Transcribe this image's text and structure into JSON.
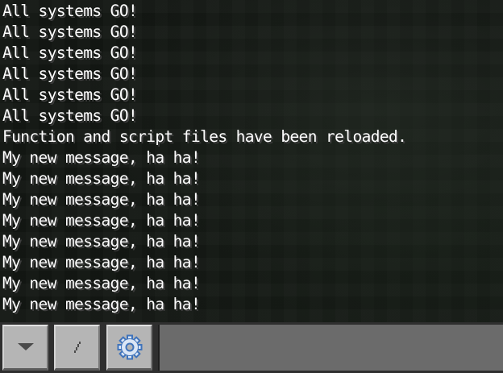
{
  "chat": {
    "lines": [
      "All systems GO!",
      "All systems GO!",
      "All systems GO!",
      "All systems GO!",
      "All systems GO!",
      "All systems GO!",
      "Function and script files have been reloaded.",
      "My new message, ha ha!",
      "My new message, ha ha!",
      "My new message, ha ha!",
      "My new message, ha ha!",
      "My new message, ha ha!",
      "My new message, ha ha!",
      "My new message, ha ha!",
      "My new message, ha ha!"
    ]
  },
  "input_bar": {
    "menu_icon": "chevron-down-icon",
    "slash_label": "/",
    "settings_icon": "gear-icon",
    "input_value": "",
    "input_placeholder": ""
  },
  "colors": {
    "chat_text": "#ffffff",
    "button_face": "#b5b5b5",
    "input_field": "#6b6b6b",
    "bar_background": "#2f2f2f",
    "gear_accent": "#3f73bb"
  }
}
